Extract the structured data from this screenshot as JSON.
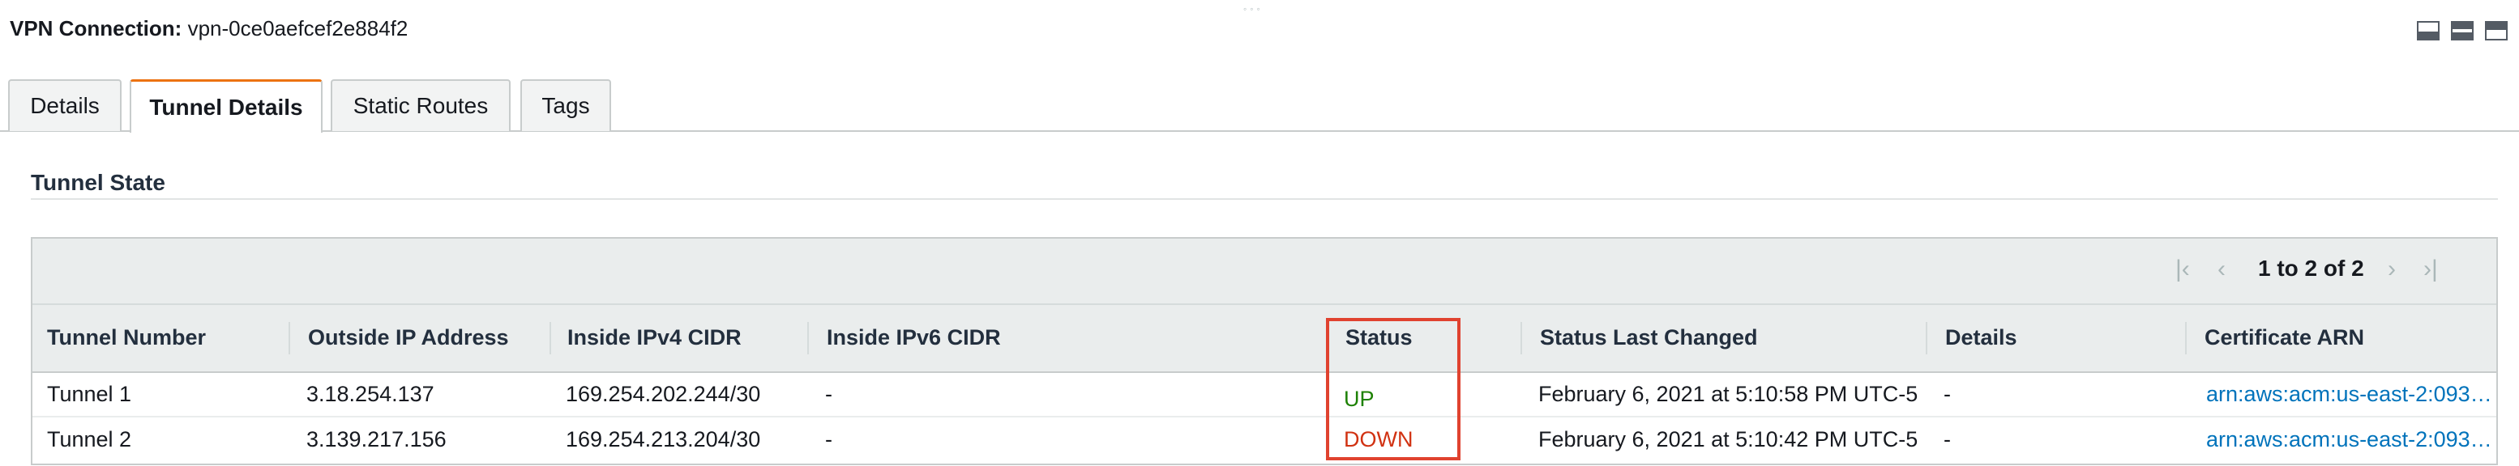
{
  "header": {
    "label": "VPN Connection:",
    "value": "vpn-0ce0aefcef2e884f2",
    "drag_handle": "◦◦◦"
  },
  "tabs": [
    {
      "label": "Details",
      "active": false
    },
    {
      "label": "Tunnel Details",
      "active": true
    },
    {
      "label": "Static Routes",
      "active": false
    },
    {
      "label": "Tags",
      "active": false
    }
  ],
  "section": {
    "title": "Tunnel State"
  },
  "pager": {
    "text": "1 to 2 of 2",
    "icons": {
      "first": "first-page-icon",
      "prev": "prev-page-icon",
      "next": "next-page-icon",
      "last": "last-page-icon"
    }
  },
  "table": {
    "columns": [
      "Tunnel Number",
      "Outside IP Address",
      "Inside IPv4 CIDR",
      "Inside IPv6 CIDR",
      "Status",
      "Status Last Changed",
      "Details",
      "Certificate ARN"
    ],
    "rows": [
      {
        "tunnel": "Tunnel 1",
        "outside_ip": "3.18.254.137",
        "ipv4": "169.254.202.244/30",
        "ipv6": "-",
        "status": "UP",
        "changed": "February 6, 2021 at 5:10:58 PM UTC-5",
        "details": "-",
        "arn": "arn:aws:acm:us-east-2:093…"
      },
      {
        "tunnel": "Tunnel 2",
        "outside_ip": "3.139.217.156",
        "ipv4": "169.254.213.204/30",
        "ipv6": "-",
        "status": "DOWN",
        "changed": "February 6, 2021 at 5:10:42 PM UTC-5",
        "details": "-",
        "arn": "arn:aws:acm:us-east-2:093…"
      }
    ]
  },
  "colors": {
    "accent_tab": "#ec7211",
    "status_up": "#1d8102",
    "status_down": "#d13212",
    "highlight": "#e0422f",
    "link": "#0073bb"
  }
}
